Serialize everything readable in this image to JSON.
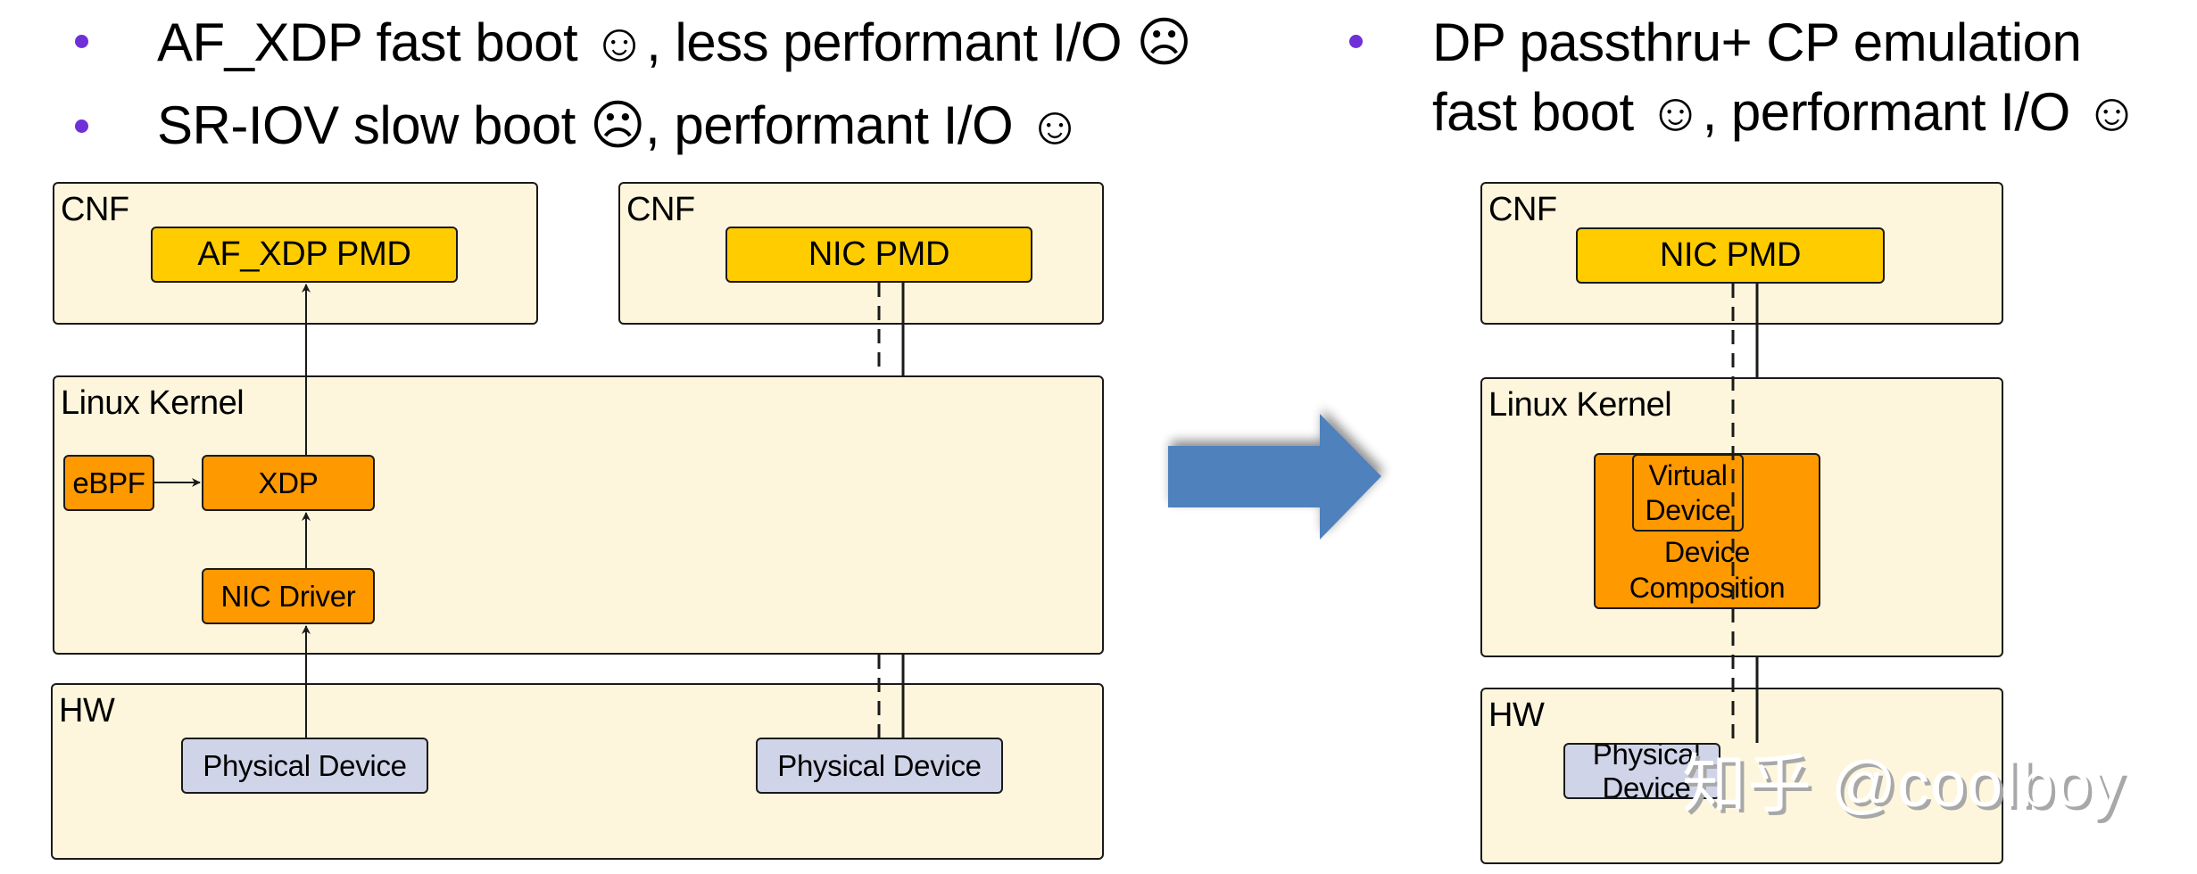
{
  "bullets_left": [
    {
      "text": "AF_XDP fast boot ☺, less performant I/O ☹"
    },
    {
      "text": "SR-IOV slow boot ☹, performant I/O ☺"
    }
  ],
  "bullets_right": [
    {
      "line1": "DP passthru+ CP emulation",
      "line2": "fast boot ☺, performant I/O ☺"
    }
  ],
  "colors": {
    "bullet": "#7030d8",
    "layer_fill": "#fdf6dc",
    "pmd_fill": "#ffcc00",
    "kernel_component_fill": "#ff9900",
    "hardware_fill": "#d0d4e8",
    "transition_arrow": "#4f81bd"
  },
  "diagram_af_xdp": {
    "cnf_label": "CNF",
    "pmd": "AF_XDP PMD",
    "kernel_label": "Linux Kernel",
    "ebpf": "eBPF",
    "xdp": "XDP",
    "nic_driver": "NIC Driver",
    "hw_label": "HW",
    "physical_device": "Physical Device"
  },
  "diagram_sriov": {
    "cnf_label": "CNF",
    "pmd": "NIC PMD",
    "physical_device": "Physical Device"
  },
  "diagram_vdpa": {
    "cnf_label": "CNF",
    "pmd": "NIC PMD",
    "kernel_label": "Linux Kernel",
    "virtual_device_line1": "Virtual",
    "virtual_device_line2": "Device",
    "composition_line1": "Device",
    "composition_line2": "Composition",
    "hw_label": "HW",
    "physical_device": "Physical Device"
  },
  "watermark": "知乎 @coolboy"
}
